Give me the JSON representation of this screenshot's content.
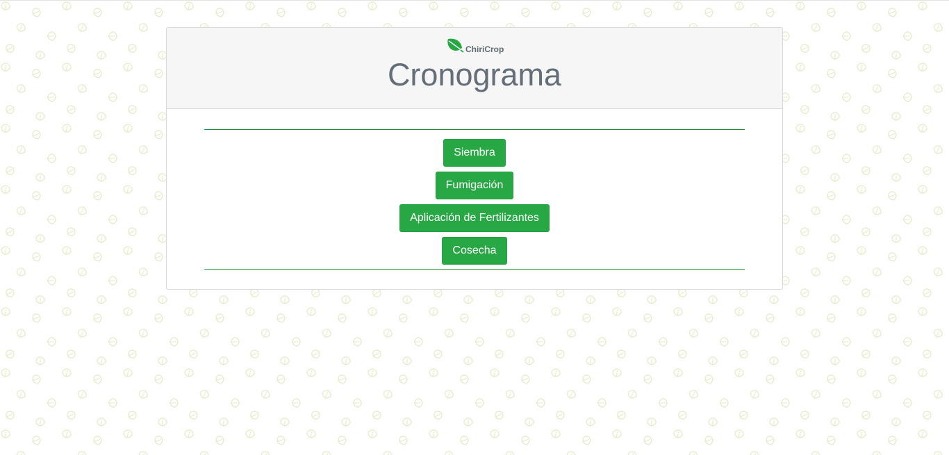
{
  "brand": {
    "name": "ChiriCrop",
    "icon": "leaf-icon",
    "color": "#28a745"
  },
  "header": {
    "title": "Cronograma"
  },
  "menu": {
    "items": [
      {
        "label": "Siembra"
      },
      {
        "label": "Fumigación"
      },
      {
        "label": "Aplicación de Fertilizantes"
      },
      {
        "label": "Cosecha"
      }
    ]
  },
  "theme": {
    "accent": "#28a745",
    "rule_color": "#1e8e3e",
    "title_color": "#636e78",
    "header_bg": "#f6f6f6",
    "background_pattern": "leaf-pattern"
  }
}
